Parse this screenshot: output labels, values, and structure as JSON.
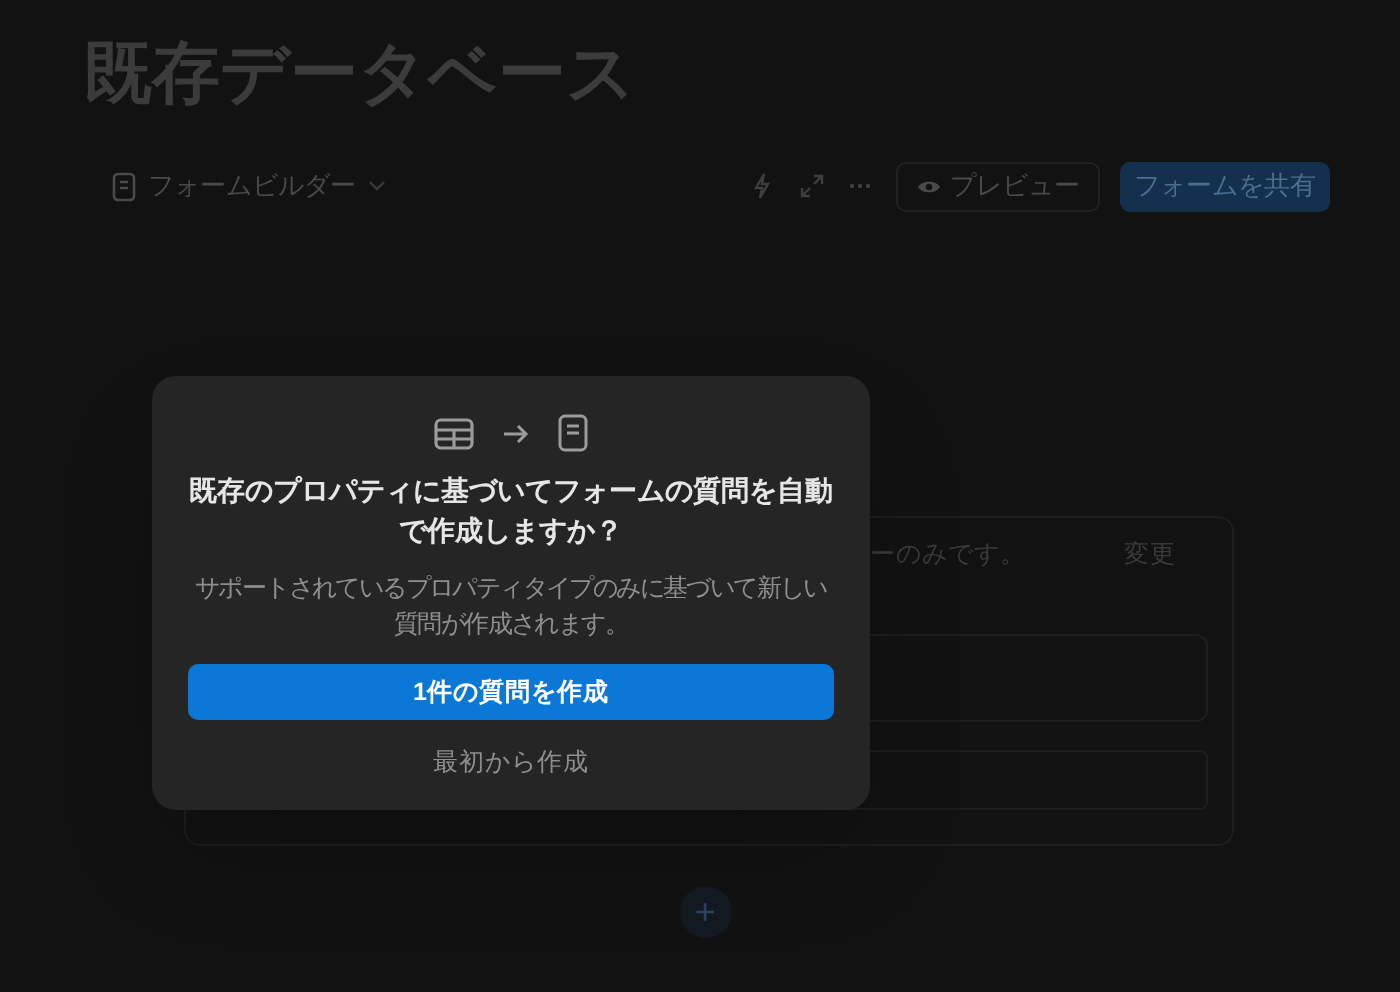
{
  "page": {
    "title": "既存データベース"
  },
  "toolbar": {
    "view_label": "フォームビルダー",
    "preview_button": "プレビュー",
    "share_button": "フォームを共有"
  },
  "form": {
    "notice_fragment": "ーのみです。",
    "change_link": "変更",
    "add_button": "+"
  },
  "dialog": {
    "heading": "既存のプロパティに基づいてフォームの質問を自動で作成しますか？",
    "description": "サポートされているプロパティタイプのみに基づいて新しい質問が作成されます。",
    "primary_button": "1件の質問を作成",
    "secondary_button": "最初から作成"
  }
}
